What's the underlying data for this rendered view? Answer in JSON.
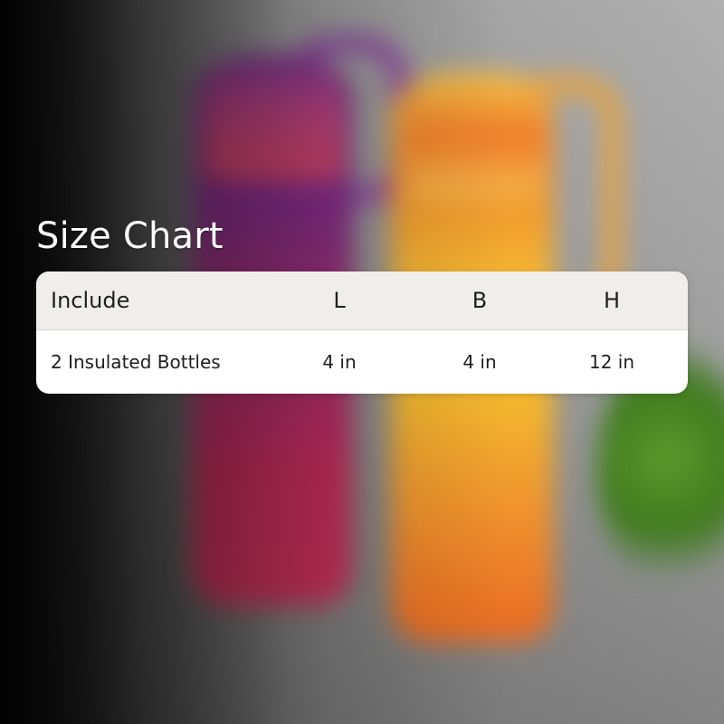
{
  "title": "Size Chart",
  "table": {
    "headers": [
      "Include",
      "L",
      "B",
      "H"
    ],
    "rows": [
      [
        "2 Insulated Bottles",
        "4 in",
        "4 in",
        "12 in"
      ]
    ]
  },
  "colors": {
    "title_text": "#ffffff",
    "header_bg": "#efeeea",
    "body_bg": "#ffffff",
    "text": "#1f1f1f",
    "bottle_left": "#9a2f6e",
    "bottle_right": "#f4ba30"
  },
  "background_objects": [
    "purple-bottle",
    "orange-bottle",
    "plant"
  ]
}
